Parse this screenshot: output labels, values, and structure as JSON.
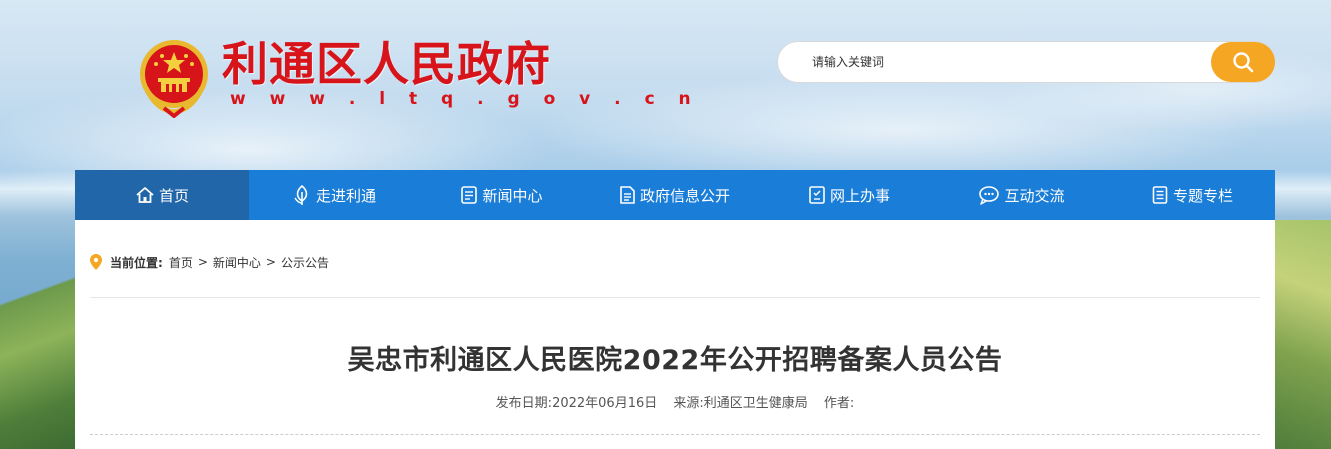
{
  "header": {
    "title": "利通区人民政府",
    "url": "w w w . l t q . g o v . c n"
  },
  "search": {
    "placeholder": "请输入关键词"
  },
  "nav": {
    "items": [
      {
        "label": "首页",
        "icon": "home-icon"
      },
      {
        "label": "走进利通",
        "icon": "leaf-icon"
      },
      {
        "label": "新闻中心",
        "icon": "news-icon"
      },
      {
        "label": "政府信息公开",
        "icon": "document-list-icon"
      },
      {
        "label": "网上办事",
        "icon": "form-icon"
      },
      {
        "label": "互动交流",
        "icon": "chat-icon"
      },
      {
        "label": "专题专栏",
        "icon": "topic-icon"
      }
    ]
  },
  "breadcrumb": {
    "label": "当前位置:",
    "items": [
      "首页",
      "新闻中心",
      "公示公告"
    ],
    "separator": ">"
  },
  "article": {
    "title": "吴忠市利通区人民医院2022年公开招聘备案人员公告",
    "date_label": "发布日期:",
    "date": "2022年06月16日",
    "source_label": "来源:",
    "source": "利通区卫生健康局",
    "author_label": "作者:",
    "author": ""
  },
  "colors": {
    "brand_red": "#d7141a",
    "nav_blue": "#1a7dd7",
    "nav_active": "#2166a8",
    "search_button": "#f5a623",
    "location_pin": "#f5a623"
  }
}
